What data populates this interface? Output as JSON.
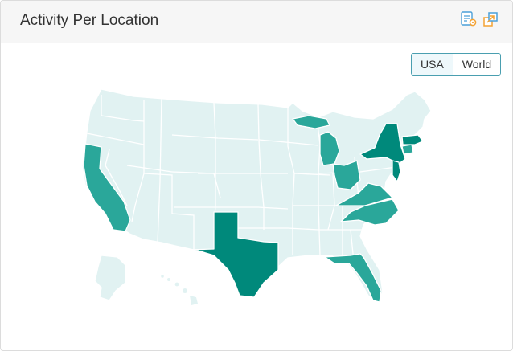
{
  "widget": {
    "title": "Activity Per Location"
  },
  "header_icons": [
    "export-data-icon",
    "expand-icon"
  ],
  "toggle": {
    "usa_label": "USA",
    "world_label": "World",
    "selected": "USA"
  },
  "colors": {
    "base": "#e1f2f2",
    "medium": "#2aa79a",
    "high": "#00897b",
    "accent": "#4a9fb0",
    "icon_orange": "#f4a233",
    "icon_blue": "#4a9fd8"
  },
  "map": {
    "region": "USA",
    "highlighted_states": [
      {
        "state": "CA",
        "level": "medium"
      },
      {
        "state": "TX",
        "level": "high"
      },
      {
        "state": "MI",
        "level": "medium"
      },
      {
        "state": "OH",
        "level": "medium"
      },
      {
        "state": "VA",
        "level": "medium"
      },
      {
        "state": "NC",
        "level": "medium"
      },
      {
        "state": "FL",
        "level": "medium"
      },
      {
        "state": "NY",
        "level": "high"
      },
      {
        "state": "NJ",
        "level": "high"
      },
      {
        "state": "MA",
        "level": "high"
      },
      {
        "state": "CT",
        "level": "medium"
      }
    ]
  }
}
